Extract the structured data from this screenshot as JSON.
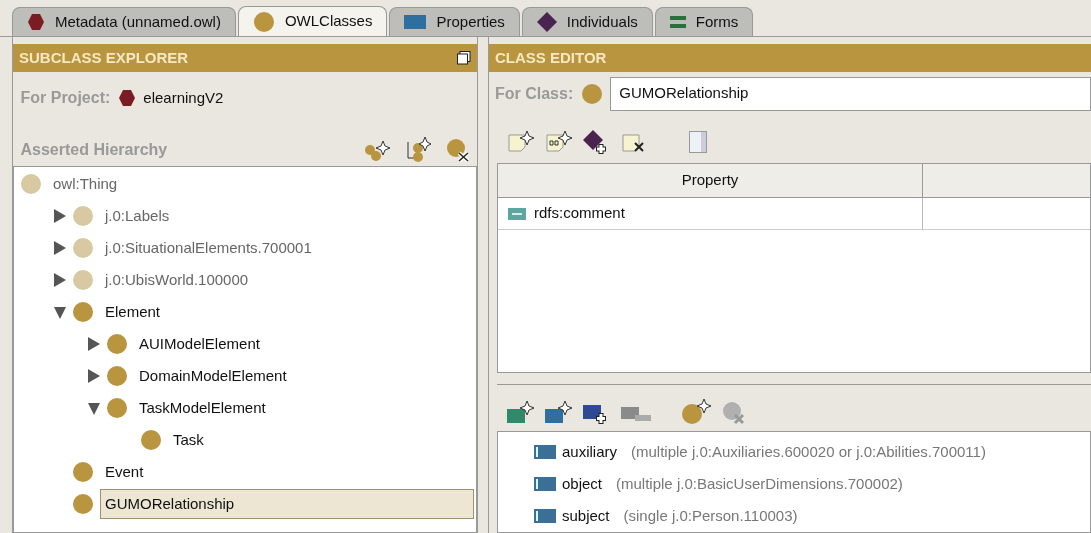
{
  "tabs": [
    {
      "label": "Metadata (unnamed.owl)",
      "kind": "hexagon",
      "selected": false
    },
    {
      "label": "OWLClasses",
      "kind": "circle",
      "selected": true
    },
    {
      "label": "Properties",
      "kind": "rect",
      "selected": false
    },
    {
      "label": "Individuals",
      "kind": "diamond",
      "selected": false
    },
    {
      "label": "Forms",
      "kind": "bars",
      "selected": false
    }
  ],
  "subclass_explorer": {
    "title": "SUBCLASS EXPLORER",
    "project_label": "For Project:",
    "project": "elearningV2",
    "hierarchy_label": "Asserted Hierarchy",
    "tree": [
      {
        "label": "owl:Thing",
        "imported": true,
        "selected": false,
        "children": [
          {
            "label": "j.0:Labels",
            "imported": true,
            "selected": false,
            "expanded": false
          },
          {
            "label": "j.0:SituationalElements.700001",
            "imported": true,
            "selected": false,
            "expanded": false
          },
          {
            "label": "j.0:UbisWorld.100000",
            "imported": true,
            "selected": false,
            "expanded": false
          },
          {
            "label": "Element",
            "imported": false,
            "selected": false,
            "expanded": true,
            "children": [
              {
                "label": "AUIModelElement",
                "imported": false,
                "selected": false,
                "expanded": false
              },
              {
                "label": "DomainModelElement",
                "imported": false,
                "selected": false,
                "expanded": false
              },
              {
                "label": "TaskModelElement",
                "imported": false,
                "selected": false,
                "expanded": true,
                "children": [
                  {
                    "label": "Task",
                    "imported": false,
                    "selected": false
                  }
                ]
              }
            ]
          },
          {
            "label": "Event",
            "imported": false,
            "selected": false
          },
          {
            "label": "GUMORelationship",
            "imported": false,
            "selected": true
          }
        ]
      }
    ]
  },
  "class_editor": {
    "title": "CLASS EDITOR",
    "class_label": "For Class:",
    "class_name": "GUMORelationship",
    "table": {
      "columns": [
        "Property"
      ],
      "rows": [
        {
          "property": "rdfs:comment"
        }
      ]
    },
    "properties": [
      {
        "name": "auxiliary",
        "range": "(multiple j.0:Auxiliaries.600020 or j.0:Abilities.700011)"
      },
      {
        "name": "object",
        "range": "(multiple j.0:BasicUserDimensions.700002)"
      },
      {
        "name": "subject",
        "range": "(single j.0:Person.110003)"
      }
    ]
  }
}
